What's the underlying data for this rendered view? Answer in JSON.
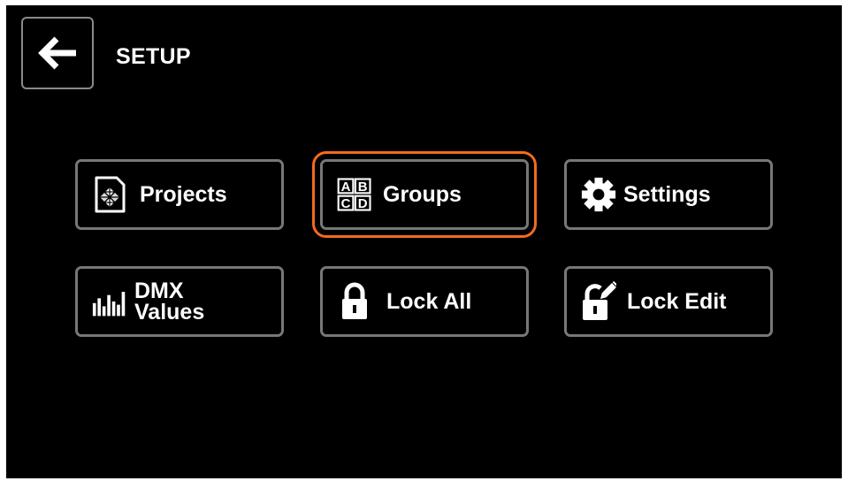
{
  "header": {
    "title": "SETUP",
    "back_icon": "arrow-left-icon"
  },
  "accent_color": "#f26b1d",
  "menu": {
    "selected": "Groups",
    "items": [
      {
        "id": "projects",
        "label": "Projects",
        "icon": "project-file-icon"
      },
      {
        "id": "groups",
        "label": "Groups",
        "icon": "abcd-groups-icon"
      },
      {
        "id": "settings",
        "label": "Settings",
        "icon": "gear-icon"
      },
      {
        "id": "dmx-values",
        "label": "DMX\nValues",
        "icon": "bar-levels-icon"
      },
      {
        "id": "lock-all",
        "label": "Lock All",
        "icon": "padlock-icon"
      },
      {
        "id": "lock-edit",
        "label": "Lock Edit",
        "icon": "lock-edit-icon"
      }
    ]
  }
}
